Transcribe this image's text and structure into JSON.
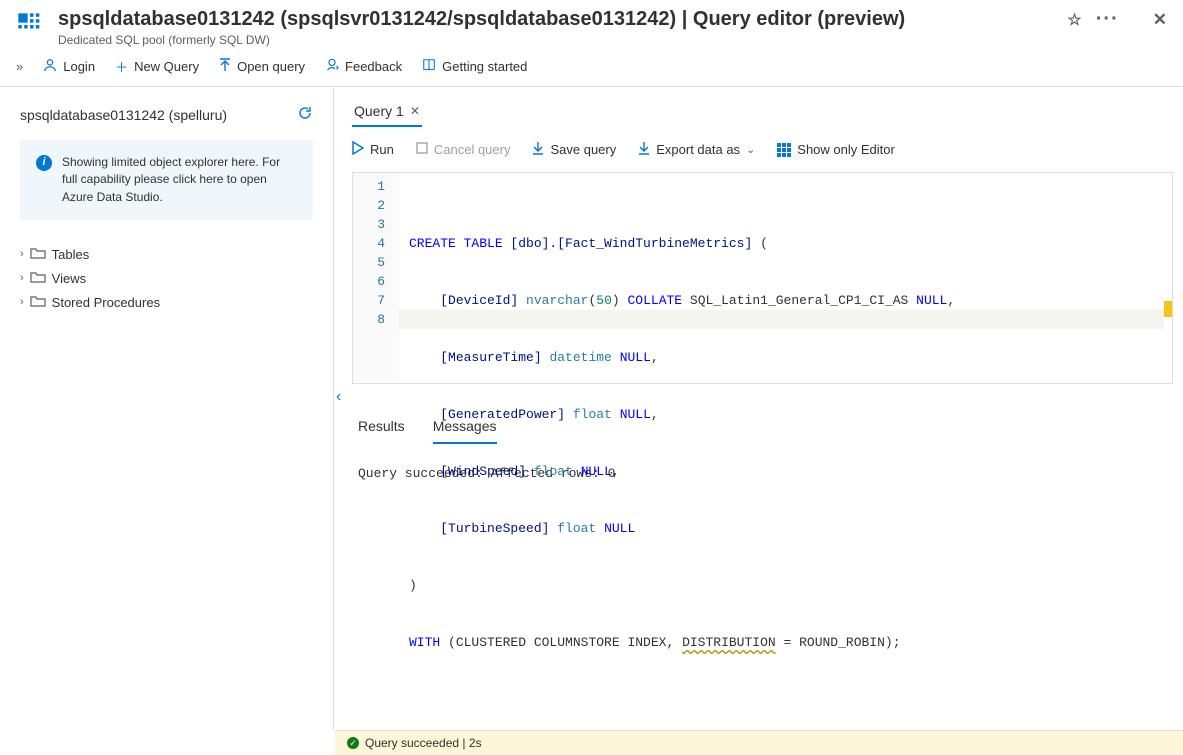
{
  "header": {
    "title": "spsqldatabase0131242 (spsqlsvr0131242/spsqldatabase0131242) | Query editor (preview)",
    "subtitle": "Dedicated SQL pool (formerly SQL DW)"
  },
  "toolbar": {
    "login": "Login",
    "new_query": "New Query",
    "open_query": "Open query",
    "feedback": "Feedback",
    "getting_started": "Getting started"
  },
  "sidebar": {
    "title": "spsqldatabase0131242 (spelluru)",
    "info": "Showing limited object explorer here. For full capability please click here to open Azure Data Studio.",
    "tree": {
      "tables": "Tables",
      "views": "Views",
      "sprocs": "Stored Procedures"
    }
  },
  "tabs": {
    "query1": "Query 1"
  },
  "querybar": {
    "run": "Run",
    "cancel": "Cancel query",
    "save": "Save query",
    "export": "Export data as",
    "show_editor": "Show only Editor"
  },
  "editor": {
    "lines": [
      "1",
      "2",
      "3",
      "4",
      "5",
      "6",
      "7",
      "8"
    ]
  },
  "code": {
    "l1_kw": "CREATE TABLE ",
    "l1_ident": "[dbo].[Fact_WindTurbineMetrics]",
    "l1_rest": " (",
    "l2_pad": "    ",
    "l2_ident": "[DeviceId]",
    "l2_sp": " ",
    "l2_type": "nvarchar",
    "l2_paren": "(",
    "l2_lit": "50",
    "l2_paren2": ") ",
    "l2_kw2": "COLLATE",
    "l2_rest": " SQL_Latin1_General_CP1_CI_AS ",
    "l2_null": "NULL",
    "l2_comma": ",",
    "l3_pad": "    ",
    "l3_ident": "[MeasureTime]",
    "l3_sp": " ",
    "l3_type": "datetime",
    "l3_sp2": " ",
    "l3_null": "NULL",
    "l3_comma": ",",
    "l4_pad": "    ",
    "l4_ident": "[GeneratedPower]",
    "l4_sp": " ",
    "l4_type": "float",
    "l4_sp2": " ",
    "l4_null": "NULL",
    "l4_comma": ",",
    "l5_pad": "    ",
    "l5_ident": "[WindSpeed]",
    "l5_sp": " ",
    "l5_type": "float",
    "l5_sp2": " ",
    "l5_null": "NULL",
    "l5_comma": ",",
    "l6_pad": "    ",
    "l6_ident": "[TurbineSpeed]",
    "l6_sp": " ",
    "l6_type": "float",
    "l6_sp2": " ",
    "l6_null": "NULL",
    "l7": ")",
    "l8_kw": "WITH",
    "l8_rest1": " (CLUSTERED COLUMNSTORE INDEX, ",
    "l8_dist": "DISTRIBUTION",
    "l8_rest2": " = ROUND_ROBIN);"
  },
  "results": {
    "tab_results": "Results",
    "tab_messages": "Messages",
    "message": "Query succeeded: Affected rows: 0"
  },
  "status": {
    "text": "Query succeeded | 2s"
  }
}
